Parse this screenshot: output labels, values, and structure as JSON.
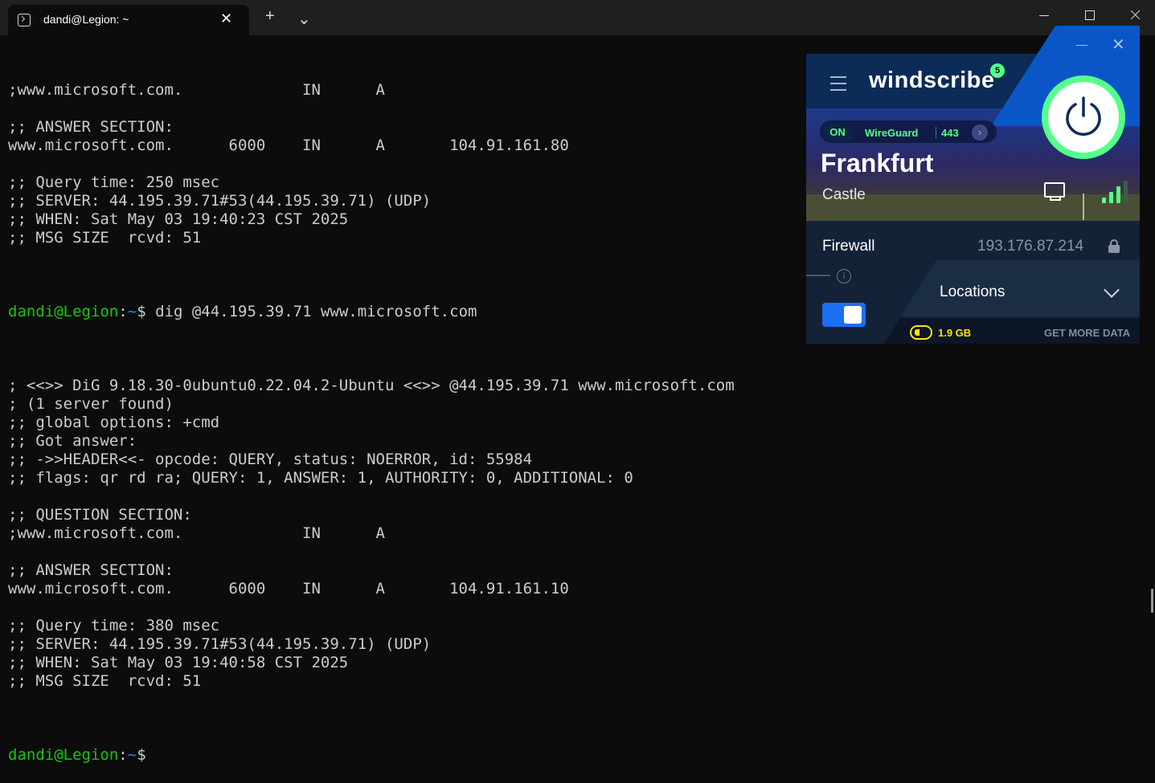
{
  "window": {
    "tab_title": "dandi@Legion: ~",
    "tab_close": "✕",
    "new_tab": "+",
    "tab_dropdown": "⌄"
  },
  "terminal": {
    "prompt": {
      "user": "dandi@Legion",
      "sep": ":",
      "path": "~",
      "dollar": "$ ",
      "command": "dig @44.195.39.71 www.microsoft.com"
    },
    "block1": [
      ";www.microsoft.com.             IN      A",
      "",
      ";; ANSWER SECTION:",
      "www.microsoft.com.      6000    IN      A       104.91.161.80",
      "",
      ";; Query time: 250 msec",
      ";; SERVER: 44.195.39.71#53(44.195.39.71) (UDP)",
      ";; WHEN: Sat May 03 19:40:23 CST 2025",
      ";; MSG SIZE  rcvd: 51",
      ""
    ],
    "block2": [
      "",
      "; <<>> DiG 9.18.30-0ubuntu0.22.04.2-Ubuntu <<>> @44.195.39.71 www.microsoft.com",
      "; (1 server found)",
      ";; global options: +cmd",
      ";; Got answer:",
      ";; ->>HEADER<<- opcode: QUERY, status: NOERROR, id: 55984",
      ";; flags: qr rd ra; QUERY: 1, ANSWER: 1, AUTHORITY: 0, ADDITIONAL: 0",
      "",
      ";; QUESTION SECTION:",
      ";www.microsoft.com.             IN      A",
      "",
      ";; ANSWER SECTION:",
      "www.microsoft.com.      6000    IN      A       104.91.161.10",
      "",
      ";; Query time: 380 msec",
      ";; SERVER: 44.195.39.71#53(44.195.39.71) (UDP)",
      ";; WHEN: Sat May 03 19:40:58 CST 2025",
      ";; MSG SIZE  rcvd: 51",
      ""
    ]
  },
  "windscribe": {
    "logo": "windscribe",
    "badge": "5",
    "status": "ON",
    "protocol": "WireGuard",
    "port": "443",
    "city": "Frankfurt",
    "node": "Castle",
    "firewall_label": "Firewall",
    "ip": "193.176.87.214",
    "firewall_on": true,
    "info": "i",
    "locations_label": "Locations",
    "data_left": "1.9 GB",
    "get_more": "GET MORE DATA",
    "close": "✕",
    "colors": {
      "accent_green": "#55ff8a",
      "accent_blue": "#0a56c6",
      "data_yellow": "#ffe600"
    },
    "signal_bars": 3
  }
}
